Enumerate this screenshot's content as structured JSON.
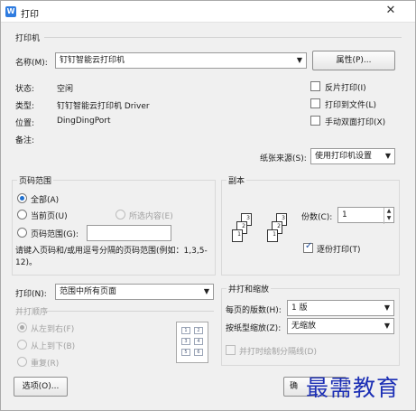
{
  "window": {
    "title": "打印",
    "app_icon_letter": "W",
    "close_glyph": "✕"
  },
  "printer": {
    "group_title": "打印机",
    "name_label": "名称(M):",
    "name_value": "钉钉智能云打印机",
    "properties_button": "属性(P)...",
    "status_label": "状态:",
    "status_value": "空闲",
    "type_label": "类型:",
    "type_value": "钉钉智能云打印机 Driver",
    "location_label": "位置:",
    "location_value": "DingDingPort",
    "comment_label": "备注:",
    "options": [
      {
        "label": "反片打印(I)",
        "checked": false
      },
      {
        "label": "打印到文件(L)",
        "checked": false
      },
      {
        "label": "手动双面打印(X)",
        "checked": false
      }
    ],
    "paper_source_label": "纸张来源(S):",
    "paper_source_value": "使用打印机设置"
  },
  "page_range": {
    "group_title": "页码范围",
    "all_label": "全部(A)",
    "current_label": "当前页(U)",
    "selection_label": "所选内容(E)",
    "pages_label": "页码范围(G):",
    "pages_value": "",
    "hint": "请键入页码和/或用逗号分隔的页码范围(例如：1,3,5-12)。",
    "selected": "all"
  },
  "print_what": {
    "label": "打印(N):",
    "value": "范围中所有页面"
  },
  "print_order": {
    "group_title": "并打顺序",
    "left_to_right": "从左到右(F)",
    "top_to_bottom": "从上到下(B)",
    "repeat": "重复(R)",
    "grid": [
      "1",
      "2",
      "3",
      "4",
      "5",
      "6"
    ]
  },
  "copies": {
    "group_title": "副本",
    "count_label": "份数(C):",
    "count_value": "1",
    "collate_label": "逐份打印(T)",
    "collate_checked": true,
    "stack_numbers": [
      "1",
      "2",
      "3"
    ]
  },
  "zoom": {
    "group_title": "并打和缩放",
    "pages_per_sheet_label": "每页的版数(H):",
    "pages_per_sheet_value": "1 版",
    "scale_label": "按纸型缩放(Z):",
    "scale_value": "无缩放",
    "draw_borders_label": "并打时绘制分隔线(D)"
  },
  "footer": {
    "options_button": "选项(O)...",
    "ok_button_partial": "确"
  },
  "watermark": {
    "text": "最需教育"
  },
  "icons": {
    "dropdown": "▼",
    "spin_up": "▲",
    "spin_down": "▼"
  }
}
